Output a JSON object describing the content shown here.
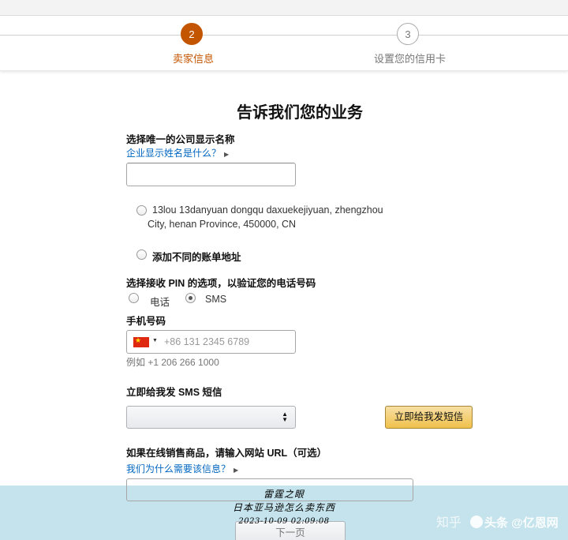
{
  "stepper": {
    "steps": [
      {
        "number": "2",
        "label": "卖家信息",
        "state": "active"
      },
      {
        "number": "3",
        "label": "设置您的信用卡",
        "state": "inactive"
      }
    ]
  },
  "page_title": "告诉我们您的业务",
  "company_name": {
    "label": "选择唯一的公司显示名称",
    "help_link": "企业显示姓名是什么？",
    "value": ""
  },
  "address_options": {
    "option1_line1": "13lou 13danyuan dongqu daxuekejiyuan, zhengzhou",
    "option1_line2": "City, henan Province, 450000, CN",
    "option2": "添加不同的账单地址"
  },
  "pin_method": {
    "label": "选择接收 PIN 的选项，以验证您的电话号码",
    "option_phone": "电话",
    "option_sms": "SMS",
    "selected": "SMS"
  },
  "mobile": {
    "label": "手机号码",
    "placeholder": "+86 131 2345 6789",
    "example": "例如 +1 206 266 1000"
  },
  "sms_section": {
    "label": "立即给我发 SMS 短信",
    "select_value": "",
    "button_label": "立即给我发短信"
  },
  "website": {
    "label": "如果在线销售商品，请输入网站 URL（可选）",
    "help_link": "我们为什么需要该信息？"
  },
  "next_button": "下一页",
  "watermark": {
    "line1": "雷霆之眼",
    "line2": "日本亚马逊怎么卖东西",
    "line3": "2023-10-09 02:09:08",
    "zhihu": "知乎",
    "brand": "头条 @亿恩网"
  },
  "colors": {
    "accent": "#c45500",
    "link": "#0066c0",
    "button_yellow": "#f0c14b",
    "footer_bg": "#c5e3ec"
  }
}
